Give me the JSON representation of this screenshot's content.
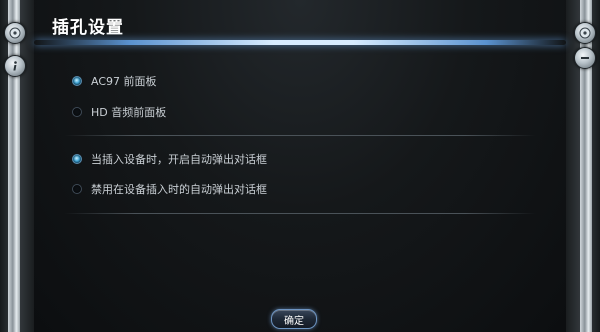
{
  "dialog": {
    "title": "插孔设置"
  },
  "panel_device": {
    "options": [
      {
        "label": "AC97 前面板",
        "selected": true
      },
      {
        "label": "HD 音频前面板",
        "selected": false
      }
    ]
  },
  "popup_behavior": {
    "options": [
      {
        "label": "当插入设备时，开启自动弹出对话框",
        "selected": true
      },
      {
        "label": "禁用在设备插入时的自动弹出对话框",
        "selected": false
      }
    ]
  },
  "buttons": {
    "ok_label": "确定"
  },
  "side_icons": {
    "left_top": "cd-icon",
    "left_second": "info-icon",
    "right_top": "cd-icon",
    "right_second": "minus-icon"
  },
  "colors": {
    "accent_glow": "#d8ecff",
    "radio_selected": "#3ea6d8"
  }
}
